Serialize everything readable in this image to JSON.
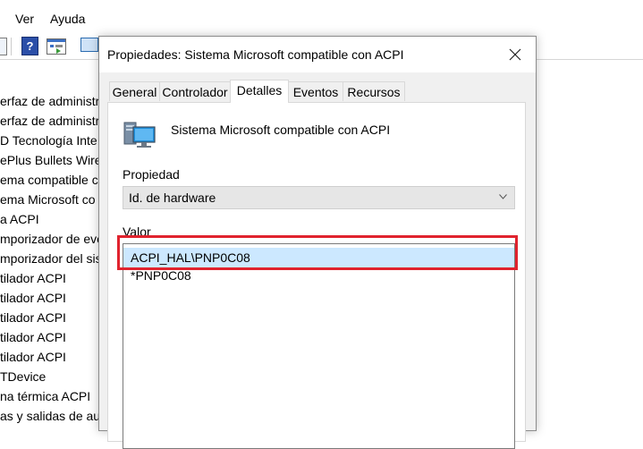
{
  "menu": {
    "items": [
      "Ver",
      "Ayuda"
    ]
  },
  "toolbar": {
    "buttons": [
      {
        "icon": "back-icon"
      },
      {
        "icon": "help-icon",
        "label": "?"
      },
      {
        "icon": "properties-icon"
      },
      {
        "icon": "scan-hardware-icon"
      }
    ]
  },
  "device_list": {
    "items": [
      "erfaz de administr",
      "erfaz de administr",
      "D Tecnología Inte",
      "ePlus Bullets Wire",
      "ema compatible c",
      "ema Microsoft co",
      "a ACPI",
      "mporizador de eve",
      "mporizador del sis",
      "tilador ACPI",
      "tilador ACPI",
      "tilador ACPI",
      "tilador ACPI",
      "tilador ACPI",
      "TDevice",
      "na térmica ACPI",
      "as y salidas de au"
    ]
  },
  "dialog": {
    "title": "Propiedades: Sistema Microsoft compatible con ACPI",
    "close_icon": "close-icon",
    "tabs": [
      {
        "label": "General",
        "active": false
      },
      {
        "label": "Controlador",
        "active": false
      },
      {
        "label": "Detalles",
        "active": true
      },
      {
        "label": "Eventos",
        "active": false
      },
      {
        "label": "Recursos",
        "active": false
      }
    ],
    "device_icon": "computer-monitor-icon",
    "device_name": "Sistema Microsoft compatible con ACPI",
    "property_label": "Propiedad",
    "property_value": "Id. de hardware",
    "value_label": "Valor",
    "values": [
      {
        "text": "ACPI_HAL\\PNP0C08",
        "selected": true
      },
      {
        "text": "*PNP0C08",
        "selected": false
      }
    ]
  },
  "colors": {
    "highlight_border": "#e0232e",
    "selected_row": "#cce8ff",
    "dialog_bg": "#f0f0f0"
  }
}
